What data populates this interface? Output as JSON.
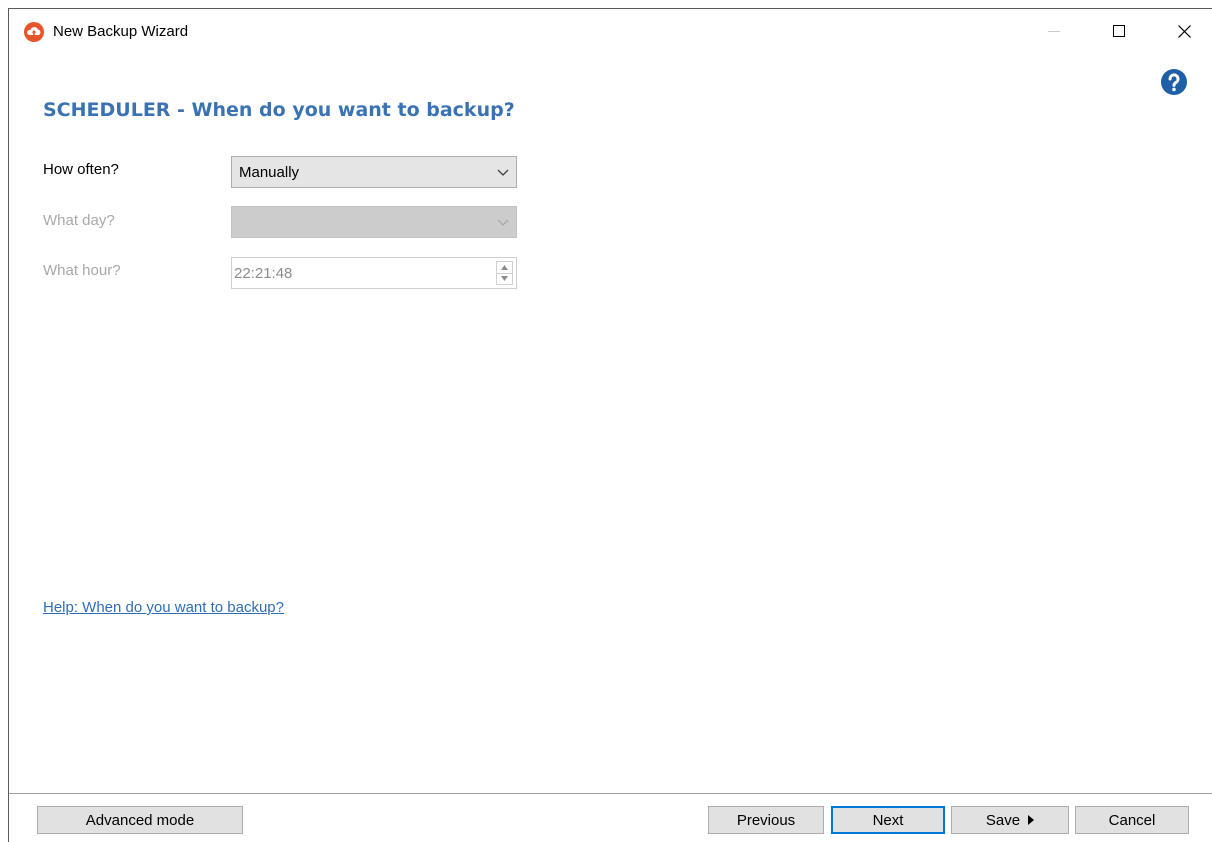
{
  "window": {
    "title": "New Backup Wizard",
    "icons": {
      "app": "cloud-upload-icon",
      "minimize": "minimize-icon",
      "maximize": "maximize-icon",
      "close": "close-icon",
      "help": "help-question-icon"
    }
  },
  "page": {
    "title": "SCHEDULER - When do you want to backup?"
  },
  "form": {
    "how_often": {
      "label": "How often?",
      "value": "Manually",
      "enabled": true
    },
    "what_day": {
      "label": "What day?",
      "value": "",
      "enabled": false
    },
    "what_hour": {
      "label": "What hour?",
      "value": "22:21:48",
      "enabled": false
    }
  },
  "help_link": "Help: When do you want to backup?",
  "buttons": {
    "advanced": "Advanced mode",
    "previous": "Previous",
    "next": "Next",
    "save": "Save",
    "cancel": "Cancel"
  },
  "colors": {
    "accent": "#3a73b4",
    "link": "#2f6db5",
    "app_icon": "#e8542b",
    "help_icon": "#1f5fa8",
    "focus_border": "#0078d7"
  }
}
